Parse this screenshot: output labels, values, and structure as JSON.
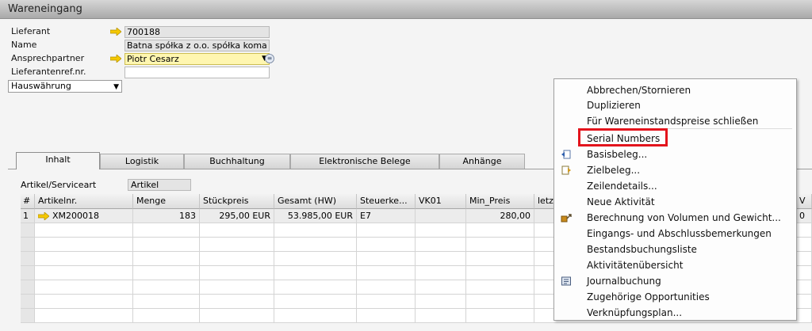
{
  "window": {
    "title": "Wareneingang"
  },
  "header": {
    "vendor": {
      "label": "Lieferant",
      "value": "700188"
    },
    "name": {
      "label": "Name",
      "value": "Batna spółka z o.o. spółka koma"
    },
    "contact": {
      "label": "Ansprechpartner",
      "value": "Piotr Cesarz"
    },
    "vendor_ref": {
      "label": "Lieferantenref.nr.",
      "value": ""
    },
    "currency": {
      "value": "Hauswährung"
    }
  },
  "tabs": [
    "Inhalt",
    "Logistik",
    "Buchhaltung",
    "Elektronische Belege",
    "Anhänge"
  ],
  "content": {
    "service_type_label": "Artikel/Serviceart",
    "service_type_value": "Artikel",
    "grid": {
      "headers": [
        "#",
        "Artikelnr.",
        "Menge",
        "Stückpreis",
        "Gesamt (HW)",
        "Steuerke...",
        "VK01",
        "Min_Preis",
        "letz",
        "V"
      ],
      "rows": [
        {
          "num": "1",
          "item": "XM200018",
          "qty": "183",
          "unit_price": "295,00 EUR",
          "total": "53.985,00 EUR",
          "tax": "E7",
          "vk01": "",
          "min_price": "280,00",
          "last": "",
          "tail": "0"
        }
      ]
    }
  },
  "context_menu": {
    "items": [
      {
        "label": "Abbrechen/Stornieren",
        "icon": ""
      },
      {
        "label": "Duplizieren",
        "icon": ""
      },
      {
        "label": "Für Wareneinstandspreise schließen",
        "icon": ""
      },
      {
        "label": "Serial Numbers",
        "icon": ""
      },
      {
        "label": "Basisbeleg...",
        "icon": "base-document-icon"
      },
      {
        "label": "Zielbeleg...",
        "icon": "target-document-icon"
      },
      {
        "label": "Zeilendetails...",
        "icon": ""
      },
      {
        "label": "Neue Aktivität",
        "icon": ""
      },
      {
        "label": "Berechnung von Volumen und Gewicht...",
        "icon": "volume-weight-icon"
      },
      {
        "label": "Eingangs- und Abschlussbemerkungen",
        "icon": ""
      },
      {
        "label": "Bestandsbuchungsliste",
        "icon": ""
      },
      {
        "label": "Aktivitätenübersicht",
        "icon": ""
      },
      {
        "label": "Journalbuchung",
        "icon": "journal-icon"
      },
      {
        "label": "Zugehörige Opportunities",
        "icon": ""
      },
      {
        "label": "Verknüpfungsplan...",
        "icon": ""
      }
    ],
    "highlighted": "Serial Numbers",
    "highlight_color": "#e3141c"
  },
  "colors": {
    "link_arrow": "#f5c800",
    "highlight_field": "#fff6b0"
  }
}
